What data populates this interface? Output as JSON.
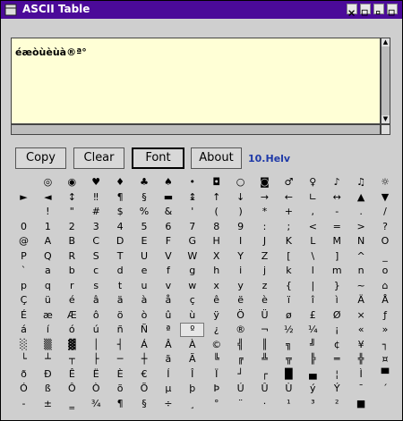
{
  "window": {
    "title": "ASCII Table"
  },
  "text_content": "éæòùèùà®ª°",
  "buttons": {
    "copy": "Copy",
    "clear": "Clear",
    "font": "Font",
    "about": "About"
  },
  "font_name": "10.Helv",
  "colors": {
    "titlebar": "#4b0a99",
    "textarea_bg": "#ffffd6",
    "font_label": "#1f3aa8"
  },
  "char_rows": [
    [
      "",
      "◎",
      "◉",
      "♥",
      "♦",
      "♣",
      "♠",
      "•",
      "◘",
      "○",
      "◙",
      "♂",
      "♀",
      "♪",
      "♫",
      "☼"
    ],
    [
      "►",
      "◄",
      "↕",
      "‼",
      "¶",
      "§",
      "▬",
      "↨",
      "↑",
      "↓",
      "→",
      "←",
      "∟",
      "↔",
      "▲",
      "▼"
    ],
    [
      "",
      "!",
      "\"",
      "#",
      "$",
      "%",
      "&",
      "'",
      "(",
      ")",
      "*",
      "+",
      ",",
      "-",
      ".",
      "/"
    ],
    [
      "0",
      "1",
      "2",
      "3",
      "4",
      "5",
      "6",
      "7",
      "8",
      "9",
      ":",
      ";",
      "<",
      "=",
      ">",
      "?"
    ],
    [
      "@",
      "A",
      "B",
      "C",
      "D",
      "E",
      "F",
      "G",
      "H",
      "I",
      "J",
      "K",
      "L",
      "M",
      "N",
      "O"
    ],
    [
      "P",
      "Q",
      "R",
      "S",
      "T",
      "U",
      "V",
      "W",
      "X",
      "Y",
      "Z",
      "[",
      "\\",
      "]",
      "^",
      "_"
    ],
    [
      "`",
      "a",
      "b",
      "c",
      "d",
      "e",
      "f",
      "g",
      "h",
      "i",
      "j",
      "k",
      "l",
      "m",
      "n",
      "o"
    ],
    [
      "p",
      "q",
      "r",
      "s",
      "t",
      "u",
      "v",
      "w",
      "x",
      "y",
      "z",
      "{",
      "|",
      "}",
      "~",
      "⌂"
    ],
    [
      "Ç",
      "ü",
      "é",
      "â",
      "ä",
      "à",
      "å",
      "ç",
      "ê",
      "ë",
      "è",
      "ï",
      "î",
      "ì",
      "Ä",
      "Å"
    ],
    [
      "É",
      "æ",
      "Æ",
      "ô",
      "ö",
      "ò",
      "û",
      "ù",
      "ÿ",
      "Ö",
      "Ü",
      "ø",
      "£",
      "Ø",
      "×",
      "ƒ"
    ],
    [
      "á",
      "í",
      "ó",
      "ú",
      "ñ",
      "Ñ",
      "ª",
      "º",
      "¿",
      "®",
      "¬",
      "½",
      "¼",
      "¡",
      "«",
      "»"
    ],
    [
      "░",
      "▒",
      "▓",
      "│",
      "┤",
      "Á",
      "Â",
      "À",
      "©",
      "╣",
      "║",
      "╗",
      "╝",
      "¢",
      "¥",
      "┐"
    ],
    [
      "└",
      "┴",
      "┬",
      "├",
      "─",
      "┼",
      "ã",
      "Ã",
      "╚",
      "╔",
      "╩",
      "╦",
      "╠",
      "═",
      "╬",
      "¤"
    ],
    [
      "ð",
      "Ð",
      "Ê",
      "Ë",
      "È",
      "€",
      "Í",
      "Î",
      "Ï",
      "┘",
      "┌",
      "█",
      "▄",
      "¦",
      "Ì",
      "▀"
    ],
    [
      "Ó",
      "ß",
      "Ô",
      "Ò",
      "õ",
      "Õ",
      "µ",
      "þ",
      "Þ",
      "Ú",
      "Û",
      "Ù",
      "ý",
      "Ý",
      "¯",
      "´"
    ],
    [
      "-",
      "±",
      "‗",
      "¾",
      "¶",
      "§",
      "÷",
      "¸",
      "°",
      "¨",
      "·",
      "¹",
      "³",
      "²",
      "■",
      ""
    ]
  ],
  "selected_char": "º"
}
